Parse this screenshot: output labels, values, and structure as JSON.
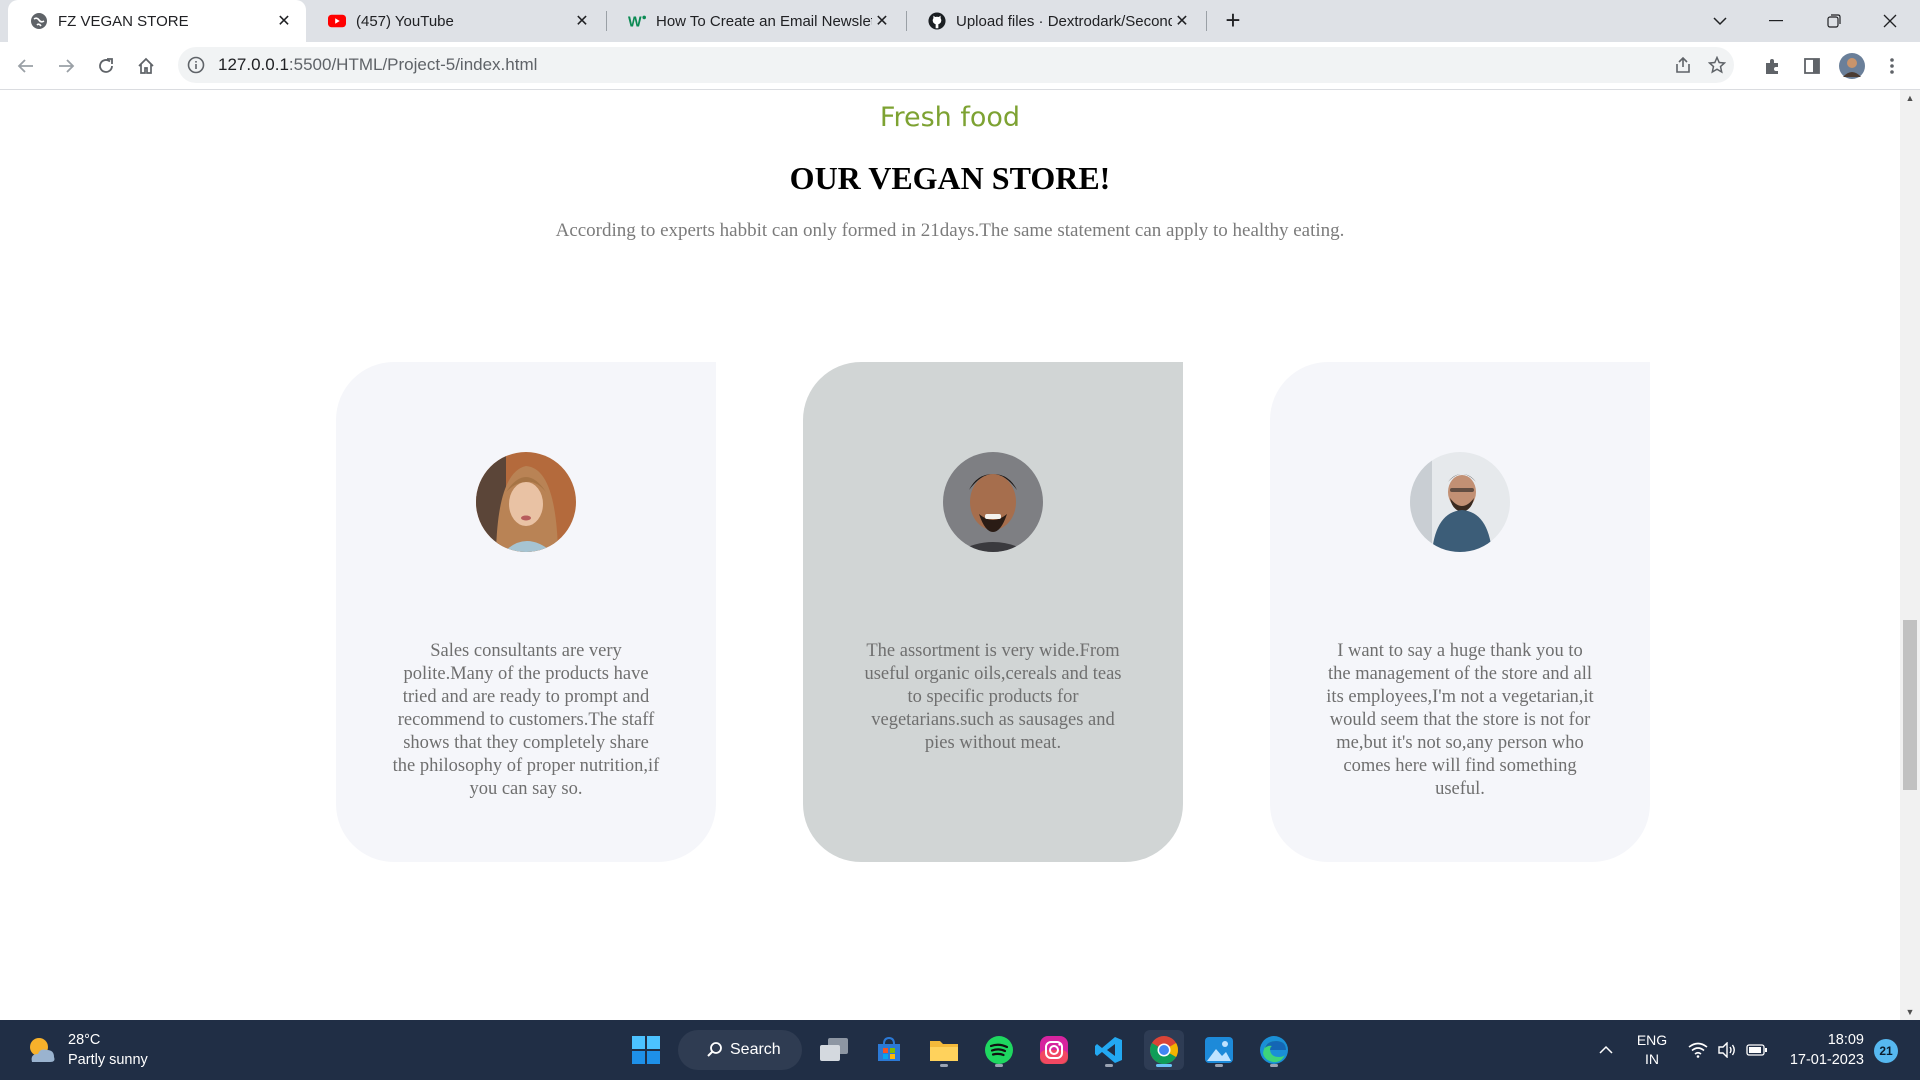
{
  "browser": {
    "tabs": [
      {
        "title": "FZ VEGAN STORE",
        "icon": "globe-icon",
        "active": true
      },
      {
        "title": "(457) YouTube",
        "icon": "youtube-icon",
        "active": false
      },
      {
        "title": "How To Create an Email Newslett",
        "icon": "wix-icon",
        "active": false
      },
      {
        "title": "Upload files · Dextrodark/Second",
        "icon": "github-icon",
        "active": false
      }
    ],
    "url_host": "127.0.0.1",
    "url_rest": ":5500/HTML/Project-5/index.html"
  },
  "page": {
    "tagline": "Fresh food",
    "heading": "OUR VEGAN STORE!",
    "subtitle": "According to experts habbit can only formed in 21days.The same statement can apply to healthy eating.",
    "testimonials": [
      {
        "text": "Sales consultants are very polite.Many of the products have tried and are ready to prompt and recommend to customers.The staff shows that they completely share the philosophy of proper nutrition,if you can say so."
      },
      {
        "text": "The assortment is very wide.From useful organic oils,cereals and teas to specific products for vegetarians.such as sausages and pies without meat."
      },
      {
        "text": "I want to say a huge thank you to the management of the store and all its employees,I'm not a vegetarian,it would seem that the store is not for me,but it's not so,any person who comes here will find something useful."
      }
    ]
  },
  "taskbar": {
    "temperature": "28°C",
    "weather": "Partly sunny",
    "search_label": "Search",
    "lang_top": "ENG",
    "lang_bottom": "IN",
    "time": "18:09",
    "date": "17-01-2023",
    "notifications": "21"
  }
}
